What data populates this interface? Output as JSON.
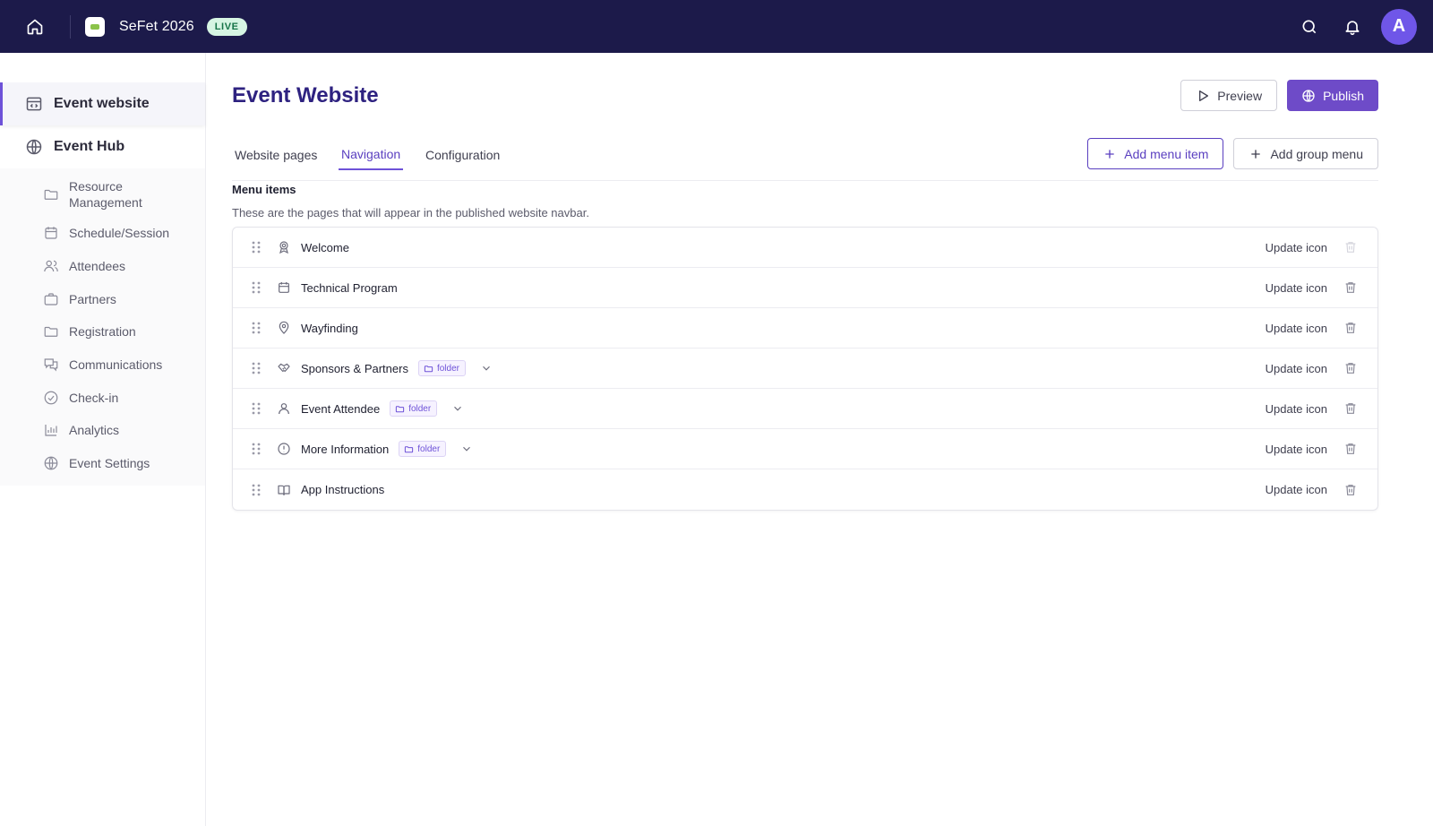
{
  "topbar": {
    "event_name": "SeFet 2026",
    "live_badge": "LIVE",
    "avatar_initial": "A"
  },
  "sidebar": {
    "main_items": [
      {
        "label": "Event website",
        "icon": "browser-code-icon",
        "active": true
      },
      {
        "label": "Event Hub",
        "icon": "globe-icon",
        "active": false
      }
    ],
    "sub_items": [
      {
        "label": "Resource Management",
        "icon": "folder-icon"
      },
      {
        "label": "Schedule/Session",
        "icon": "calendar-icon"
      },
      {
        "label": "Attendees",
        "icon": "users-icon"
      },
      {
        "label": "Partners",
        "icon": "briefcase-icon"
      },
      {
        "label": "Registration",
        "icon": "folder-icon"
      },
      {
        "label": "Communications",
        "icon": "chat-icon"
      },
      {
        "label": "Check-in",
        "icon": "check-circle-icon"
      },
      {
        "label": "Analytics",
        "icon": "bar-chart-icon"
      },
      {
        "label": "Event Settings",
        "icon": "globe-icon"
      }
    ]
  },
  "header": {
    "title": "Event Website",
    "preview_label": "Preview",
    "publish_label": "Publish"
  },
  "tabs": [
    {
      "label": "Website pages",
      "active": false
    },
    {
      "label": "Navigation",
      "active": true
    },
    {
      "label": "Configuration",
      "active": false
    }
  ],
  "actions": {
    "add_menu_item": "Add menu item",
    "add_group_menu": "Add group menu"
  },
  "section": {
    "title": "Menu items",
    "description": "These are the pages that will appear in the published website navbar."
  },
  "menu_items": [
    {
      "label": "Welcome",
      "icon": "award-icon",
      "folder": false,
      "delete_disabled": true
    },
    {
      "label": "Technical Program",
      "icon": "calendar-icon",
      "folder": false,
      "delete_disabled": false
    },
    {
      "label": "Wayfinding",
      "icon": "map-pin-icon",
      "folder": false,
      "delete_disabled": false
    },
    {
      "label": "Sponsors & Partners",
      "icon": "handshake-icon",
      "folder": true,
      "delete_disabled": false
    },
    {
      "label": "Event Attendee",
      "icon": "user-icon",
      "folder": true,
      "delete_disabled": false
    },
    {
      "label": "More Information",
      "icon": "info-icon",
      "folder": true,
      "delete_disabled": false
    },
    {
      "label": "App Instructions",
      "icon": "book-icon",
      "folder": false,
      "delete_disabled": false
    }
  ],
  "labels": {
    "folder": "folder",
    "update_icon": "Update icon"
  },
  "colors": {
    "topbar_bg": "#1c1a4a",
    "accent": "#6e4bc8",
    "title": "#2e2280",
    "live_bg": "#d6f5e3",
    "live_text": "#157347"
  }
}
